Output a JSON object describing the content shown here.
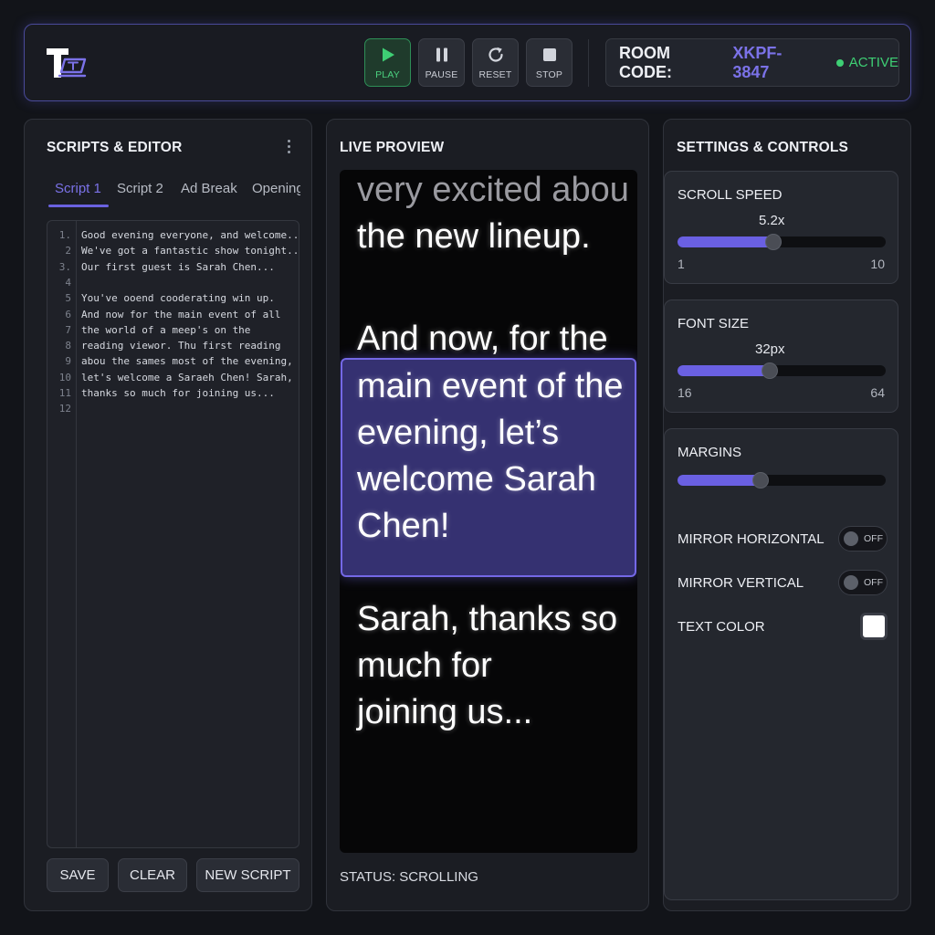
{
  "header": {
    "logo_icon": "teleprompter-logo-icon",
    "controls": [
      {
        "label": "PLAY",
        "icon": "play-icon"
      },
      {
        "label": "PAUSE",
        "icon": "pause-icon"
      },
      {
        "label": "RESET",
        "icon": "reset-icon"
      },
      {
        "label": "STOP",
        "icon": "stop-icon"
      }
    ],
    "room_label": "ROOM CODE:",
    "room_code": "XKPF-3847",
    "status": "ACTIVE"
  },
  "editor": {
    "title": "SCRIPTS & EDITOR",
    "tabs": [
      "Script 1",
      "Script 2",
      "Ad Break",
      "Opening"
    ],
    "active_tab": "Script 1",
    "lines": [
      {
        "n": "1.",
        "text": "Good evening everyone, and welcome..."
      },
      {
        "n": "2",
        "text": "We've got a fantastic show tonight..."
      },
      {
        "n": "3.",
        "text": "Our first guest is Sarah Chen..."
      },
      {
        "n": "4",
        "text": ""
      },
      {
        "n": "5",
        "text": "You've ooend cooderating win up."
      },
      {
        "n": "6",
        "text": "And now for the main event of all"
      },
      {
        "n": "7",
        "text": "the world of a meep's on the"
      },
      {
        "n": "8",
        "text": "reading viewor. Thu first reading"
      },
      {
        "n": "9",
        "text": "abou the sames most of the evening,"
      },
      {
        "n": "10",
        "text": "let's welcome a Saraeh Chen! Sarah,"
      },
      {
        "n": "11",
        "text": "thanks so much for joining us..."
      },
      {
        "n": "12",
        "text": ""
      }
    ],
    "buttons": {
      "save": "SAVE",
      "clear": "CLEAR",
      "new_script": "NEW SCRIPT"
    }
  },
  "preview": {
    "title": "LIVE PROVIEW",
    "lines": [
      "very excited abou",
      "the new lineup.",
      "And now, for the",
      "main event of the",
      "evening, let’s",
      "welcome Sarah",
      "Chen!",
      "Sarah, thanks so",
      "much for",
      "joining us..."
    ],
    "status": "STATUS: SCROLLING"
  },
  "settings": {
    "title": "SETTINGS & CONTROLS",
    "scroll_speed": {
      "label": "SCROLL SPEED",
      "value": 5.2,
      "value_text": "5.2x",
      "min": "1",
      "max": "10",
      "min_num": 1,
      "max_num": 10
    },
    "font_size": {
      "label": "FONT SIZE",
      "value": 32,
      "value_text": "32px",
      "min": "16",
      "max": "64",
      "min_num": 16,
      "max_num": 64
    },
    "margins": {
      "label": "MARGINS",
      "fraction": 0.4
    },
    "mirror_horizontal": {
      "label": "MIRROR HORIZONTAL",
      "state": "OFF"
    },
    "mirror_vertical": {
      "label": "MIRROR VERTICAL",
      "state": "OFF"
    },
    "text_color": {
      "label": "TEXT COLOR",
      "value": "#ffffff"
    }
  },
  "colors": {
    "accent": "#6a60e2",
    "active_green": "#3ecf74",
    "play_green": "#4bd07f"
  }
}
